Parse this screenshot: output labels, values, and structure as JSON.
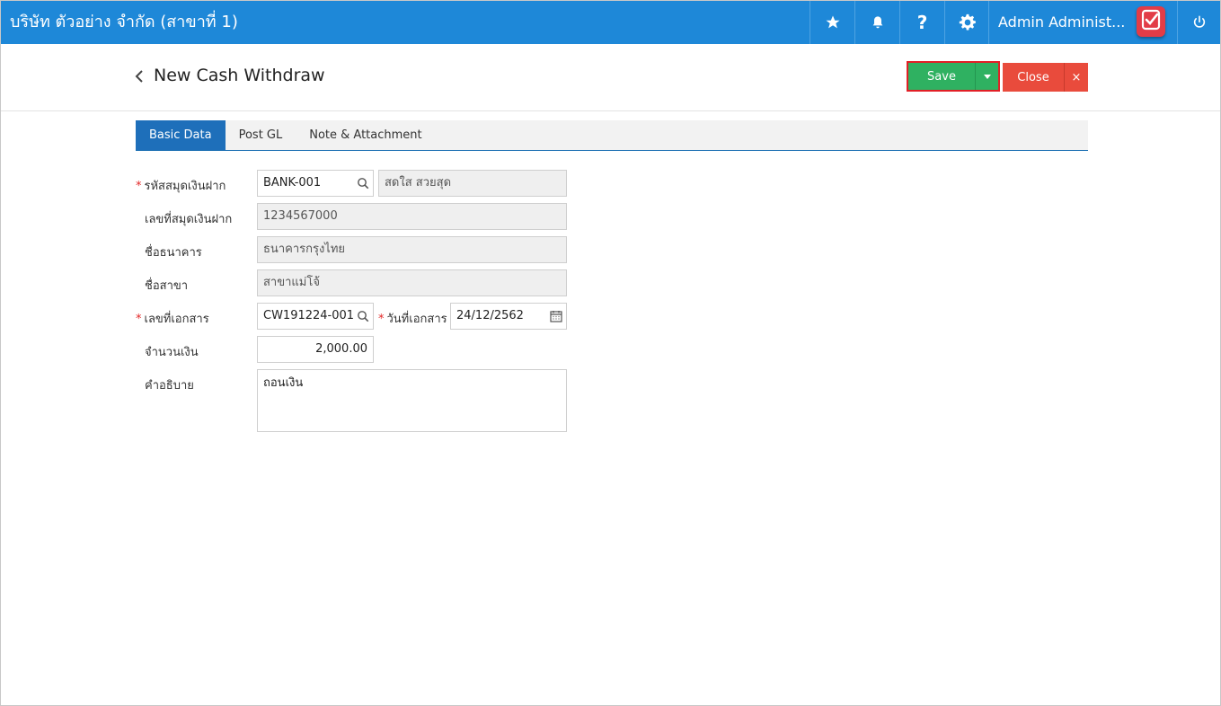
{
  "topbar": {
    "company": "บริษัท ตัวอย่าง จำกัด (สาขาที่ 1)",
    "user_name": "Admin Administ...",
    "icons": [
      "star-icon",
      "bell-icon",
      "help-icon",
      "gear-icon",
      "power-icon"
    ],
    "background": "#1e88d8"
  },
  "header": {
    "title": "New Cash Withdraw",
    "save_label": "Save",
    "close_label": "Close",
    "close_x": "×"
  },
  "tabs": [
    "Basic Data",
    "Post GL",
    "Note & Attachment"
  ],
  "form": {
    "bank_book_code": {
      "label": "รหัสสมุดเงินฝาก",
      "value": "BANK-001",
      "name": "สดใส สวยสุด"
    },
    "bank_book_no": {
      "label": "เลขที่สมุดเงินฝาก",
      "value": "1234567000"
    },
    "bank_name": {
      "label": "ชื่อธนาคาร",
      "value": "ธนาคารกรุงไทย"
    },
    "branch_name": {
      "label": "ชื่อสาขา",
      "value": "สาขาแม่โจ้"
    },
    "doc_no": {
      "label": "เลขที่เอกสาร",
      "value": "CW191224-001"
    },
    "doc_date": {
      "label": "วันที่เอกสาร",
      "value": "24/12/2562"
    },
    "amount": {
      "label": "จำนวนเงิน",
      "value": "2,000.00"
    },
    "description": {
      "label": "คำอธิบาย",
      "value": "ถอนเงิน"
    },
    "required_mark": "*"
  },
  "colors": {
    "save": "#2fb161",
    "close": "#e94b3c",
    "tab_active": "#1e6fba",
    "highlight": "#e21f26"
  }
}
